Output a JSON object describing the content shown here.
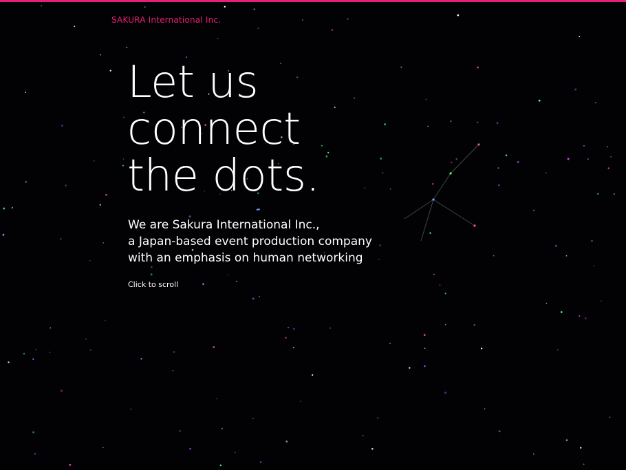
{
  "brand": {
    "name": "SAKURA International Inc.",
    "color": "#e91e78"
  },
  "hero": {
    "headline_lines": [
      "Let us",
      "connect",
      "the dots."
    ],
    "intro_lines": [
      "We are Sakura International Inc.,",
      "a Japan-based event production company",
      "with an emphasis on human networking"
    ],
    "scroll_label": "Click to scroll"
  },
  "theme": {
    "background": "#020204",
    "text": "#ffffff",
    "accent": "#e91e78",
    "star_colors": [
      "#ff4fb0",
      "#4fff7a",
      "#7aa2ff",
      "#ffffff",
      "#c04dff"
    ]
  }
}
